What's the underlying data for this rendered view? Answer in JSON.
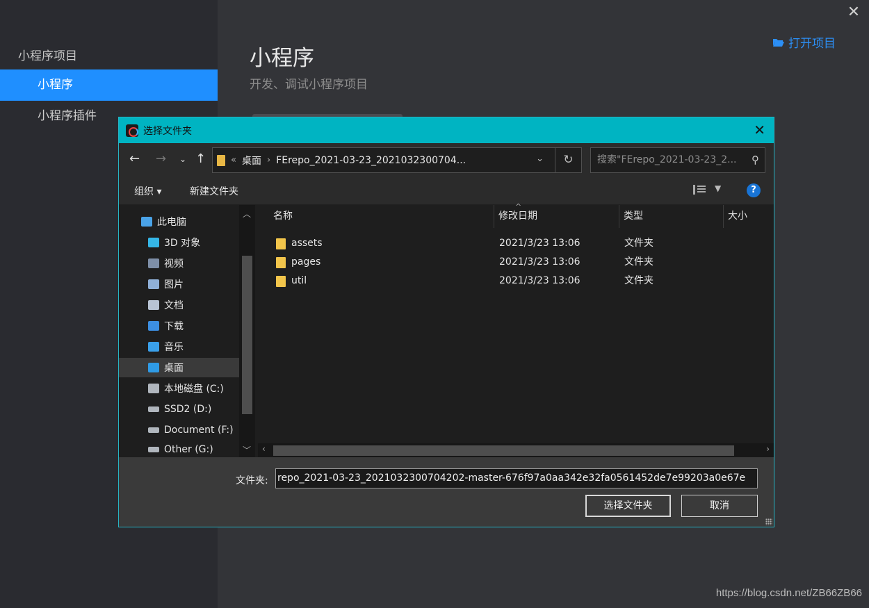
{
  "app": {
    "section_title": "小程序项目",
    "nav": [
      "小程序",
      "小程序插件"
    ],
    "main_title": "小程序",
    "main_subtitle": "开发、调试小程序项目",
    "open_project": "打开项目",
    "close_glyph": "✕"
  },
  "dialog": {
    "title": "选择文件夹",
    "close_glyph": "✕",
    "breadcrumb_prefix": "«",
    "breadcrumb": [
      "桌面",
      "FErepo_2021-03-23_2021032300704..."
    ],
    "search_placeholder": "搜索\"FErepo_2021-03-23_2...",
    "toolbar": {
      "organize": "组织 ▾",
      "new_folder": "新建文件夹"
    },
    "tree": [
      {
        "label": "此电脑",
        "icon": "computer-icon",
        "color": "#4aa3e8"
      },
      {
        "label": "3D 对象",
        "icon": "cube-icon",
        "color": "#35b7e8"
      },
      {
        "label": "视频",
        "icon": "video-icon",
        "color": "#7e8fa8"
      },
      {
        "label": "图片",
        "icon": "picture-icon",
        "color": "#8fb0d8"
      },
      {
        "label": "文档",
        "icon": "document-icon",
        "color": "#b8c4d4"
      },
      {
        "label": "下载",
        "icon": "download-icon",
        "color": "#3c8ee0"
      },
      {
        "label": "音乐",
        "icon": "music-icon",
        "color": "#3aa0ea"
      },
      {
        "label": "桌面",
        "icon": "desktop-icon",
        "color": "#2f9be6"
      },
      {
        "label": "本地磁盘 (C:)",
        "icon": "drive-icon",
        "color": "#b0b6bd"
      },
      {
        "label": "SSD2 (D:)",
        "icon": "drive-icon",
        "color": "#b0b6bd"
      },
      {
        "label": "Document (F:)",
        "icon": "drive-icon",
        "color": "#b0b6bd"
      },
      {
        "label": "Other (G:)",
        "icon": "drive-icon",
        "color": "#b0b6bd"
      }
    ],
    "columns": [
      "名称",
      "修改日期",
      "类型",
      "大小"
    ],
    "files": [
      {
        "name": "assets",
        "date": "2021/3/23 13:06",
        "type": "文件夹"
      },
      {
        "name": "pages",
        "date": "2021/3/23 13:06",
        "type": "文件夹"
      },
      {
        "name": "util",
        "date": "2021/3/23 13:06",
        "type": "文件夹"
      }
    ],
    "folder_label": "文件夹:",
    "folder_value": "repo_2021-03-23_2021032300704202-master-676f97a0aa342e32fa0561452de7e99203a0e67e",
    "select_button": "选择文件夹",
    "cancel_button": "取消"
  },
  "watermark": "https://blog.csdn.net/ZB66ZB66",
  "colors": {
    "accent": "#1f8fff",
    "titlebar": "#00b4c2",
    "folder": "#f2c54b"
  }
}
